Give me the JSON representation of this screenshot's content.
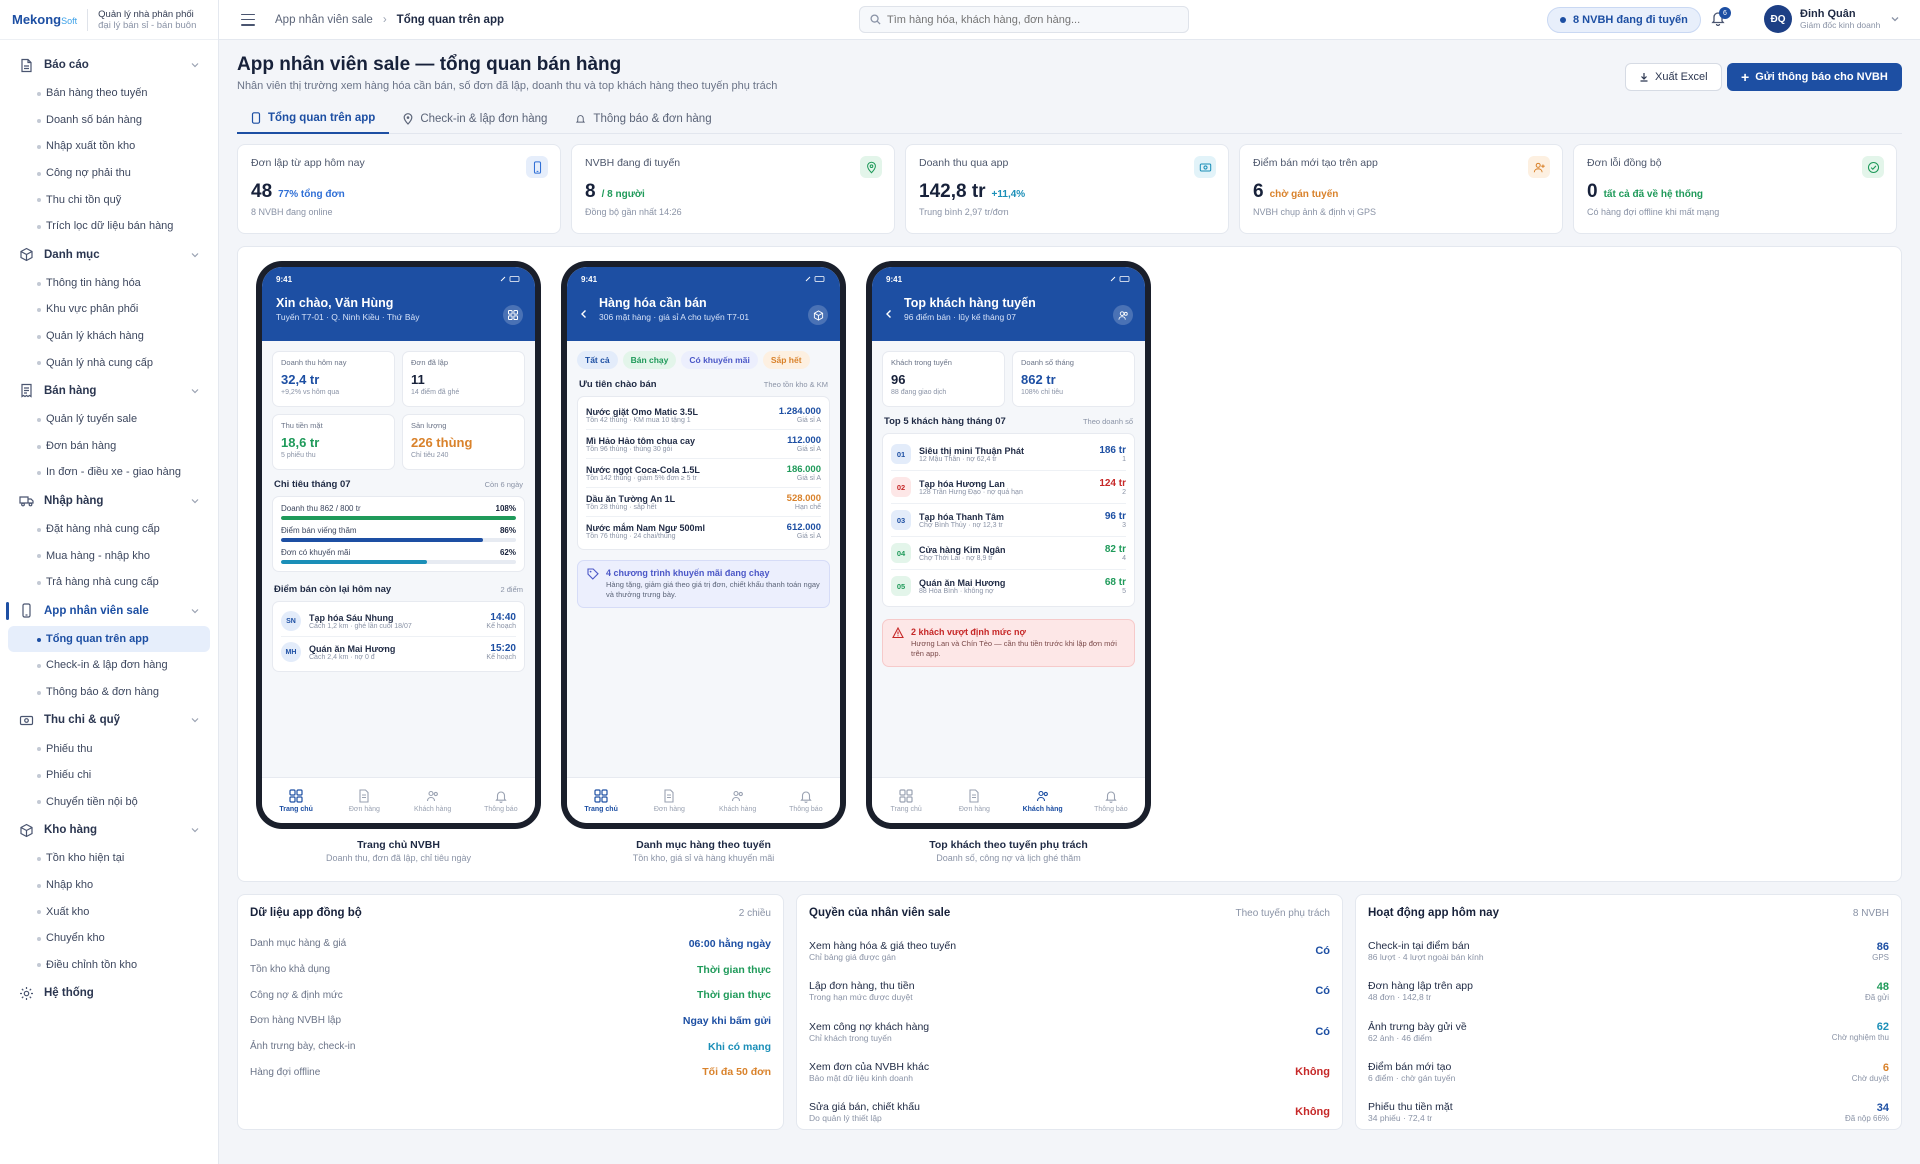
{
  "brand": {
    "name": "Mekong",
    "suffix": "Soft",
    "tag1": "Quản lý nhà phân phối",
    "tag2": "đại lý bán sỉ - bán buôn"
  },
  "sidebar": {
    "groups": [
      {
        "label": "Báo cáo",
        "icon": "report-icon",
        "items": [
          "Bán hàng theo tuyến",
          "Doanh số bán hàng",
          "Nhập xuất tồn kho",
          "Công nợ phải thu",
          "Thu chi tồn quỹ",
          "Trích lọc dữ liệu bán hàng"
        ]
      },
      {
        "label": "Danh mục",
        "icon": "box-icon",
        "items": [
          "Thông tin hàng hóa",
          "Khu vực phân phối",
          "Quản lý khách hàng",
          "Quản lý nhà cung cấp"
        ]
      },
      {
        "label": "Bán hàng",
        "icon": "receipt-icon",
        "items": [
          "Quản lý tuyến sale",
          "Đơn bán hàng",
          "In đơn - điều xe - giao hàng"
        ]
      },
      {
        "label": "Nhập hàng",
        "icon": "truck-icon",
        "items": [
          "Đặt hàng nhà cung cấp",
          "Mua hàng - nhập kho",
          "Trả hàng nhà cung cấp"
        ]
      },
      {
        "label": "App nhân viên sale",
        "icon": "phone-icon",
        "items": [
          "Tổng quan trên app",
          "Check-in & lập đơn hàng",
          "Thông báo & đơn hàng"
        ]
      },
      {
        "label": "Thu chi & quỹ",
        "icon": "cash-icon",
        "items": [
          "Phiếu thu",
          "Phiếu chi",
          "Chuyển tiền nội bộ"
        ]
      },
      {
        "label": "Kho hàng",
        "icon": "warehouse-icon",
        "items": [
          "Tồn kho hiện tại",
          "Nhập kho",
          "Xuất kho",
          "Chuyển kho",
          "Điều chỉnh tồn kho"
        ]
      }
    ],
    "system": "Hệ thống"
  },
  "topbar": {
    "crumb_parent": "App nhân viên sale",
    "crumb_current": "Tổng quan trên app",
    "search_placeholder": "Tìm hàng hóa, khách hàng, đơn hàng...",
    "status_pill": "8 NVBH đang đi tuyến",
    "notif_count": "6",
    "user_initials": "ĐQ",
    "user_name": "Đinh Quân",
    "user_role": "Giám đốc kinh doanh"
  },
  "page": {
    "title": "App nhân viên sale — tổng quan bán hàng",
    "subtitle": "Nhân viên thị trường xem hàng hóa cần bán, số đơn đã lập, doanh thu và top khách hàng theo tuyến phụ trách",
    "btn_excel": "Xuất Excel",
    "btn_send": "Gửi thông báo cho NVBH",
    "tabs": [
      "Tổng quan trên app",
      "Check-in & lập đơn hàng",
      "Thông báo & đơn hàng"
    ]
  },
  "kpis": [
    {
      "label": "Đơn lập từ app hôm nay",
      "value": "48",
      "delta": "77% tổng đơn",
      "note": "8 NVBH đang online",
      "icon": "phone-icon",
      "color": "#2f6fd6",
      "bg": "#e6eefb"
    },
    {
      "label": "NVBH đang đi tuyến",
      "value": "8",
      "delta": "/ 8 người",
      "note": "Đồng bộ gần nhất 14:26",
      "icon": "map-pin-icon",
      "color": "#1f9a5a",
      "bg": "#e3f5ea"
    },
    {
      "label": "Doanh thu qua app",
      "value": "142,8 tr",
      "delta": "+11,4%",
      "note": "Trung bình 2,97 tr/đơn",
      "icon": "cash-icon",
      "color": "#1b8fb8",
      "bg": "#e2f3f9"
    },
    {
      "label": "Điểm bán mới tạo trên app",
      "value": "6",
      "delta": "chờ gán tuyến",
      "note": "NVBH chụp ảnh & định vị GPS",
      "icon": "user-plus-icon",
      "color": "#d9822b",
      "bg": "#fdf0e1"
    },
    {
      "label": "Đơn lỗi đồng bộ",
      "value": "0",
      "delta": "tất cả đã về hệ thống",
      "note": "Có hàng đợi offline khi mất mạng",
      "icon": "check-circle-icon",
      "color": "#1f9a5a",
      "bg": "#e3f5ea"
    }
  ],
  "phone1": {
    "time": "9:41",
    "title": "Xin chào, Văn Hùng",
    "sub": "Tuyến T7-01 · Q. Ninh Kiều · Thứ Bảy",
    "cards": [
      {
        "label": "Doanh thu hôm nay",
        "value": "32,4 tr",
        "note": "+9,2% vs hôm qua",
        "color": "#1d4fa3"
      },
      {
        "label": "Đơn đã lập",
        "value": "11",
        "note": "14 điểm đã ghé",
        "color": "#17213a"
      },
      {
        "label": "Thu tiền mặt",
        "value": "18,6 tr",
        "note": "5 phiếu thu",
        "color": "#1f9a5a"
      },
      {
        "label": "Sản lượng",
        "value": "226 thùng",
        "note": "Chỉ tiêu 240",
        "color": "#d9822b"
      }
    ],
    "target_title": "Chỉ tiêu tháng 07",
    "target_note": "Còn 6 ngày",
    "bars": [
      {
        "label": "Doanh thu 862 / 800 tr",
        "pct": "108%",
        "fill": 1.0,
        "color": "#1f9a5a"
      },
      {
        "label": "Điểm bán viếng thăm",
        "pct": "86%",
        "fill": 0.86,
        "color": "#1d4fa3"
      },
      {
        "label": "Đơn có khuyến mãi",
        "pct": "62%",
        "fill": 0.62,
        "color": "#1b8fb8"
      }
    ],
    "stops_title": "Điểm bán còn lại hôm nay",
    "stops_note": "2 điểm",
    "stops": [
      {
        "initials": "SN",
        "name": "Tạp hóa Sáu Nhung",
        "sub": "Cách 1,2 km · ghé lần cuối 18/07",
        "time": "14:40",
        "plan": "Kế hoạch"
      },
      {
        "initials": "MH",
        "name": "Quán ăn Mai Hương",
        "sub": "Cách 2,4 km · nợ 0 đ",
        "time": "15:20",
        "plan": "Kế hoạch"
      }
    ],
    "caption": "Trang chủ NVBH",
    "caption_sub": "Doanh thu, đơn đã lập, chỉ tiêu ngày"
  },
  "phone2": {
    "time": "9:41",
    "title": "Hàng hóa cần bán",
    "sub": "306 mặt hàng · giá sỉ A cho tuyến T7-01",
    "chips": [
      {
        "label": "Tất cả",
        "bg": "#e3ecfa",
        "color": "#1d4fa3"
      },
      {
        "label": "Bán chạy",
        "bg": "#e3f5ea",
        "color": "#1f9a5a"
      },
      {
        "label": "Có khuyến mãi",
        "bg": "#eceffd",
        "color": "#4b57c7"
      },
      {
        "label": "Sắp hết",
        "bg": "#fdf0e1",
        "color": "#d9822b"
      }
    ],
    "sec_title": "Ưu tiên chào bán",
    "sec_note": "Theo tồn kho & KM",
    "products": [
      {
        "name": "Nước giặt Omo Matic 3.5L",
        "sub": "Tồn 42 thùng · KM mua 10 tặng 1",
        "price": "1.284.000",
        "grade": "Giá sỉ A",
        "color": "#1d4fa3"
      },
      {
        "name": "Mì Hảo Hảo tôm chua cay",
        "sub": "Tồn 96 thùng · thùng 30 gói",
        "price": "112.000",
        "grade": "Giá sỉ A",
        "color": "#1d4fa3"
      },
      {
        "name": "Nước ngọt Coca-Cola 1.5L",
        "sub": "Tồn 142 thùng · giảm 5% đơn ≥ 5 tr",
        "price": "186.000",
        "grade": "Giá sỉ A",
        "color": "#1f9a5a"
      },
      {
        "name": "Dầu ăn Tường An 1L",
        "sub": "Tồn 28 thùng · sắp hết",
        "price": "528.000",
        "grade": "Hạn chế",
        "color": "#d9822b"
      },
      {
        "name": "Nước mắm Nam Ngư 500ml",
        "sub": "Tồn 76 thùng · 24 chai/thùng",
        "price": "612.000",
        "grade": "Giá sỉ A",
        "color": "#1d4fa3"
      }
    ],
    "promo_title": "4 chương trình khuyến mãi đang chạy",
    "promo_desc": "Hàng tặng, giảm giá theo giá trị đơn, chiết khấu thanh toán ngay và thưởng trưng bày.",
    "caption": "Danh mục hàng theo tuyến",
    "caption_sub": "Tồn kho, giá sỉ và hàng khuyến mãi"
  },
  "phone3": {
    "time": "9:41",
    "title": "Top khách hàng tuyến",
    "sub": "96 điểm bán · lũy kế tháng 07",
    "cards": [
      {
        "label": "Khách trong tuyến",
        "value": "96",
        "note": "88 đang giao dịch",
        "color": "#17213a"
      },
      {
        "label": "Doanh số tháng",
        "value": "862 tr",
        "note": "108% chỉ tiêu",
        "color": "#1d4fa3"
      }
    ],
    "sec_title": "Top 5 khách hàng tháng 07",
    "sec_note": "Theo doanh số",
    "customers": [
      {
        "rank": "01",
        "name": "Siêu thị mini Thuận Phát",
        "sub": "12 Mậu Thân · nợ 62,4 tr",
        "value": "186 tr",
        "idx": "1",
        "color": "#1d4fa3",
        "bg": "#e3ecfa"
      },
      {
        "rank": "02",
        "name": "Tạp hóa Hương Lan",
        "sub": "128 Trần Hưng Đạo · nợ quá hạn",
        "value": "124 tr",
        "idx": "2",
        "color": "#c62828",
        "bg": "#fde7e7"
      },
      {
        "rank": "03",
        "name": "Tạp hóa Thanh Tâm",
        "sub": "Chợ Bình Thủy · nợ 12,3 tr",
        "value": "96 tr",
        "idx": "3",
        "color": "#1d4fa3",
        "bg": "#e3ecfa"
      },
      {
        "rank": "04",
        "name": "Cửa hàng Kim Ngân",
        "sub": "Chợ Thới Lai · nợ 8,9 tr",
        "value": "82 tr",
        "idx": "4",
        "color": "#1f9a5a",
        "bg": "#e3f5ea"
      },
      {
        "rank": "05",
        "name": "Quán ăn Mai Hương",
        "sub": "88 Hòa Bình · không nợ",
        "value": "68 tr",
        "idx": "5",
        "color": "#1f9a5a",
        "bg": "#e3f5ea"
      }
    ],
    "alert_title": "2 khách vượt định mức nợ",
    "alert_desc": "Hương Lan và Chín Tèo — cần thu tiền trước khi lập đơn mới trên app.",
    "caption": "Top khách theo tuyến phụ trách",
    "caption_sub": "Doanh số, công nợ và lịch ghé thăm"
  },
  "tabbar": [
    "Trang chủ",
    "Đơn hàng",
    "Khách hàng",
    "Thông báo"
  ],
  "sync": {
    "title": "Dữ liệu app đồng bộ",
    "note": "2 chiều",
    "rows": [
      {
        "label": "Danh mục hàng & giá",
        "value": "06:00 hằng ngày",
        "color": "#1d4fa3"
      },
      {
        "label": "Tồn kho khả dụng",
        "value": "Thời gian thực",
        "color": "#1f9a5a"
      },
      {
        "label": "Công nợ & định mức",
        "value": "Thời gian thực",
        "color": "#1f9a5a"
      },
      {
        "label": "Đơn hàng NVBH lập",
        "value": "Ngay khi bấm gửi",
        "color": "#1d4fa3"
      },
      {
        "label": "Ảnh trưng bày, check-in",
        "value": "Khi có mạng",
        "color": "#1b8fb8"
      },
      {
        "label": "Hàng đợi offline",
        "value": "Tối đa 50 đơn",
        "color": "#d9822b"
      }
    ]
  },
  "perms": {
    "title": "Quyền của nhân viên sale",
    "note": "Theo tuyến phụ trách",
    "rows": [
      {
        "label": "Xem hàng hóa & giá theo tuyến",
        "sub": "Chỉ bảng giá được gán",
        "value": "Có",
        "color": "#1d4fa3"
      },
      {
        "label": "Lập đơn hàng, thu tiền",
        "sub": "Trong hạn mức được duyệt",
        "value": "Có",
        "color": "#1d4fa3"
      },
      {
        "label": "Xem công nợ khách hàng",
        "sub": "Chỉ khách trong tuyến",
        "value": "Có",
        "color": "#1d4fa3"
      },
      {
        "label": "Xem đơn của NVBH khác",
        "sub": "Bảo mật dữ liệu kinh doanh",
        "value": "Không",
        "color": "#c62828"
      },
      {
        "label": "Sửa giá bán, chiết khấu",
        "sub": "Do quản lý thiết lập",
        "value": "Không",
        "color": "#c62828"
      }
    ]
  },
  "activity": {
    "title": "Hoạt động app hôm nay",
    "note": "8 NVBH",
    "rows": [
      {
        "label": "Check-in tại điểm bán",
        "sub": "86 lượt · 4 lượt ngoài bán kính",
        "value": "86",
        "badge": "GPS",
        "color": "#1d4fa3"
      },
      {
        "label": "Đơn hàng lập trên app",
        "sub": "48 đơn · 142,8 tr",
        "value": "48",
        "badge": "Đã gửi",
        "color": "#1f9a5a"
      },
      {
        "label": "Ảnh trưng bày gửi về",
        "sub": "62 ảnh · 46 điểm",
        "value": "62",
        "badge": "Chờ nghiệm thu",
        "color": "#1b8fb8"
      },
      {
        "label": "Điểm bán mới tạo",
        "sub": "6 điểm · chờ gán tuyến",
        "value": "6",
        "badge": "Chờ duyệt",
        "color": "#d9822b"
      },
      {
        "label": "Phiếu thu tiền mặt",
        "sub": "34 phiếu · 72,4 tr",
        "value": "34",
        "badge": "Đã nộp 66%",
        "color": "#1d4fa3"
      }
    ]
  }
}
